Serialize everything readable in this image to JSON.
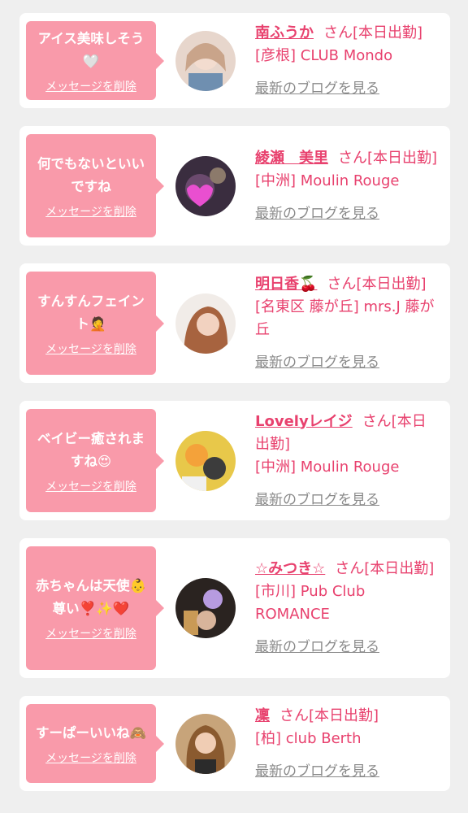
{
  "delete_label": "メッセージを削除",
  "blog_label": "最新のブログを見る",
  "suffix": "さん[本日出勤]",
  "colors": {
    "bubble": "#f99aaa",
    "accent": "#e8416e",
    "link_gray": "#8a8a8a",
    "background": "#efefef"
  },
  "items": [
    {
      "message": "アイス美味しそう🤍",
      "name": "南ふうか",
      "shop": "[彦根] CLUB Mondo"
    },
    {
      "message": "何でもないといいですね",
      "name": "綾瀬　美里",
      "shop": "[中洲] Moulin Rouge"
    },
    {
      "message": "すんすんフェイント🤦",
      "name": "明日香🍒",
      "shop": "[名東区 藤が丘] mrs.J 藤が丘"
    },
    {
      "message": "ベイビー癒されますね😍",
      "name": "Lovelyレイジ",
      "shop": "[中洲] Moulin Rouge"
    },
    {
      "message": "赤ちゃんは天使👶尊い❣️✨❤️",
      "name": "☆みつき☆",
      "shop": "[市川] Pub Club ROMANCE"
    },
    {
      "message": "すーぱーいいね🙈",
      "name": "凜",
      "shop": "[柏] club Berth"
    }
  ]
}
